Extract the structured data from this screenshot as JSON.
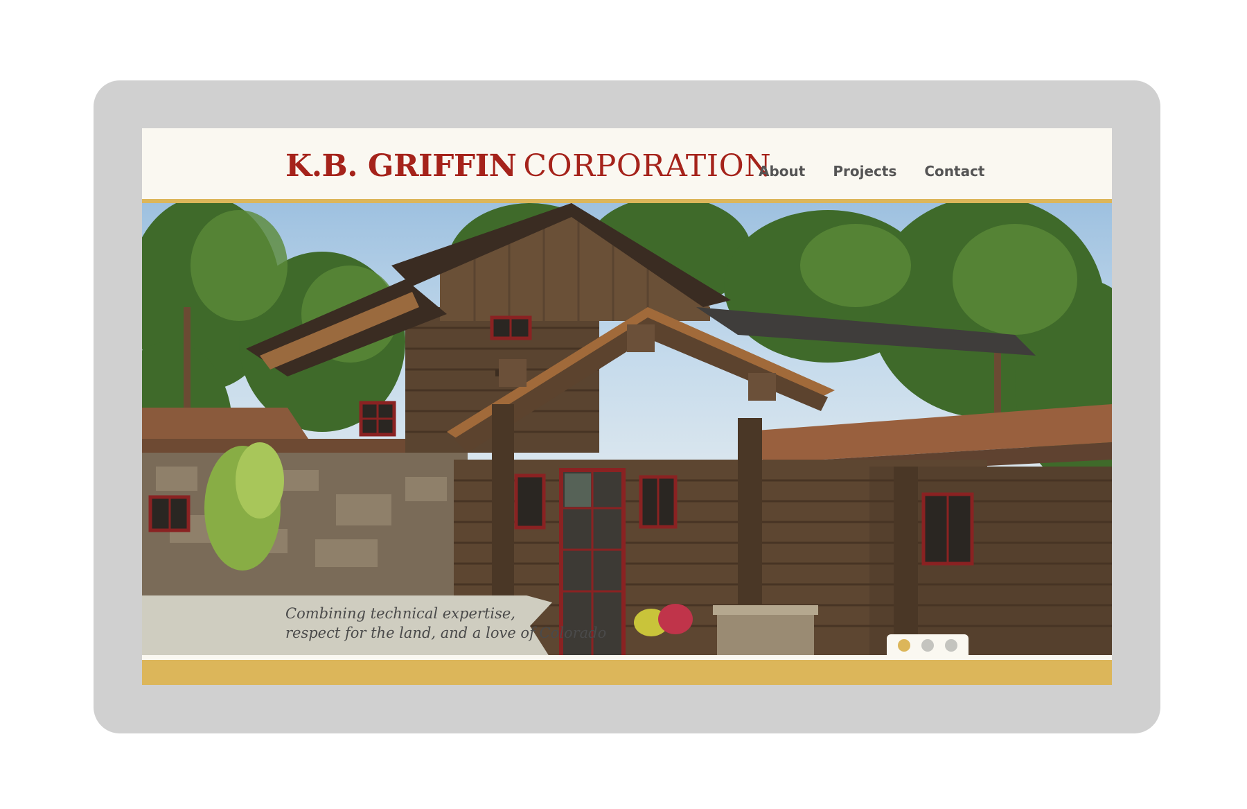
{
  "brand": {
    "name_bold": "K.B. GRIFFIN",
    "name_light": "CORPORATION"
  },
  "nav": {
    "items": [
      {
        "label": "About"
      },
      {
        "label": "Projects"
      },
      {
        "label": "Contact"
      }
    ]
  },
  "hero": {
    "image_subject": "rustic timber and stone mountain home among pine trees",
    "caption_line1": "Combining technical expertise,",
    "caption_line2": "respect for the land, and a love of Colorado",
    "slides_total": 3,
    "active_slide": 1
  },
  "colors": {
    "brand_red": "#a5231b",
    "accent_gold": "#dcb65a",
    "header_bg": "#faf8f1",
    "nav_text": "#545454",
    "device_frame": "#d0d0d0",
    "caption_banner": "#cfcdc0"
  }
}
